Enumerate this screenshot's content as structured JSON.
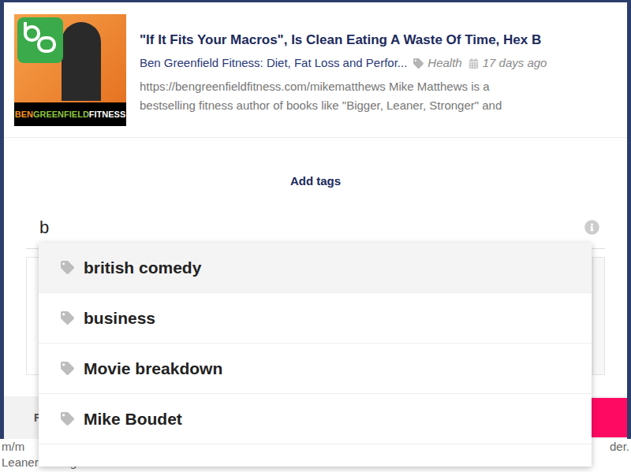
{
  "podcast": {
    "title": "\"If It Fits Your Macros\", Is Clean Eating A Waste Of Time, Hex B",
    "show": "Ben Greenfield Fitness: Diet, Fat Loss and Perfor...",
    "category": "Health",
    "age": "17 days ago",
    "description": [
      "https://bengreenfieldfitness.com/mikematthews Mike Matthews is a",
      "bestselling fitness author of books like \"Bigger, Leaner, Stronger\" and"
    ],
    "thumbnail": {
      "brand": [
        "BEN",
        "GREENFIELD",
        "FITNESS"
      ]
    }
  },
  "tag_editor": {
    "heading": "Add tags",
    "input_value": "b"
  },
  "suggestions": [
    {
      "label": "british comedy",
      "selected": true
    },
    {
      "label": "business",
      "selected": false
    },
    {
      "label": "Movie breakdown",
      "selected": false
    },
    {
      "label": "Mike Boudet",
      "selected": false
    }
  ],
  "footer": {
    "left_label": "F"
  },
  "background_text": [
    "m/m",
    "der.",
    "Leaner Stronger."
  ]
}
